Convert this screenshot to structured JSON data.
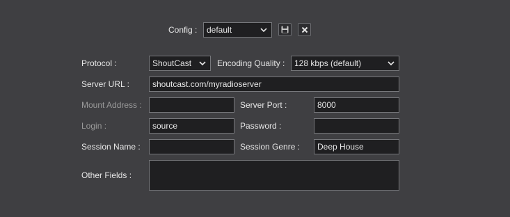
{
  "config": {
    "label": "Config :",
    "selected": "default",
    "save_icon": "floppy-disk-icon",
    "delete_icon": "close-icon"
  },
  "form": {
    "protocol": {
      "label": "Protocol :",
      "value": "ShoutCast"
    },
    "encoding_quality": {
      "label": "Encoding Quality :",
      "value": "128 kbps (default)"
    },
    "server_url": {
      "label": "Server URL :",
      "value": "shoutcast.com/myradioserver"
    },
    "mount_address": {
      "label": "Mount Address :",
      "value": ""
    },
    "server_port": {
      "label": "Server Port :",
      "value": "8000"
    },
    "login": {
      "label": "Login :",
      "value": "source"
    },
    "password": {
      "label": "Password :",
      "value": ""
    },
    "session_name": {
      "label": "Session Name :",
      "value": ""
    },
    "session_genre": {
      "label": "Session Genre :",
      "value": "Deep House"
    },
    "other_fields": {
      "label": "Other Fields :",
      "value": ""
    }
  },
  "colors": {
    "background": "#3f3f42",
    "field_background": "#1f1f21",
    "field_border": "#77787c",
    "dim_label": "#9a9a9a"
  }
}
